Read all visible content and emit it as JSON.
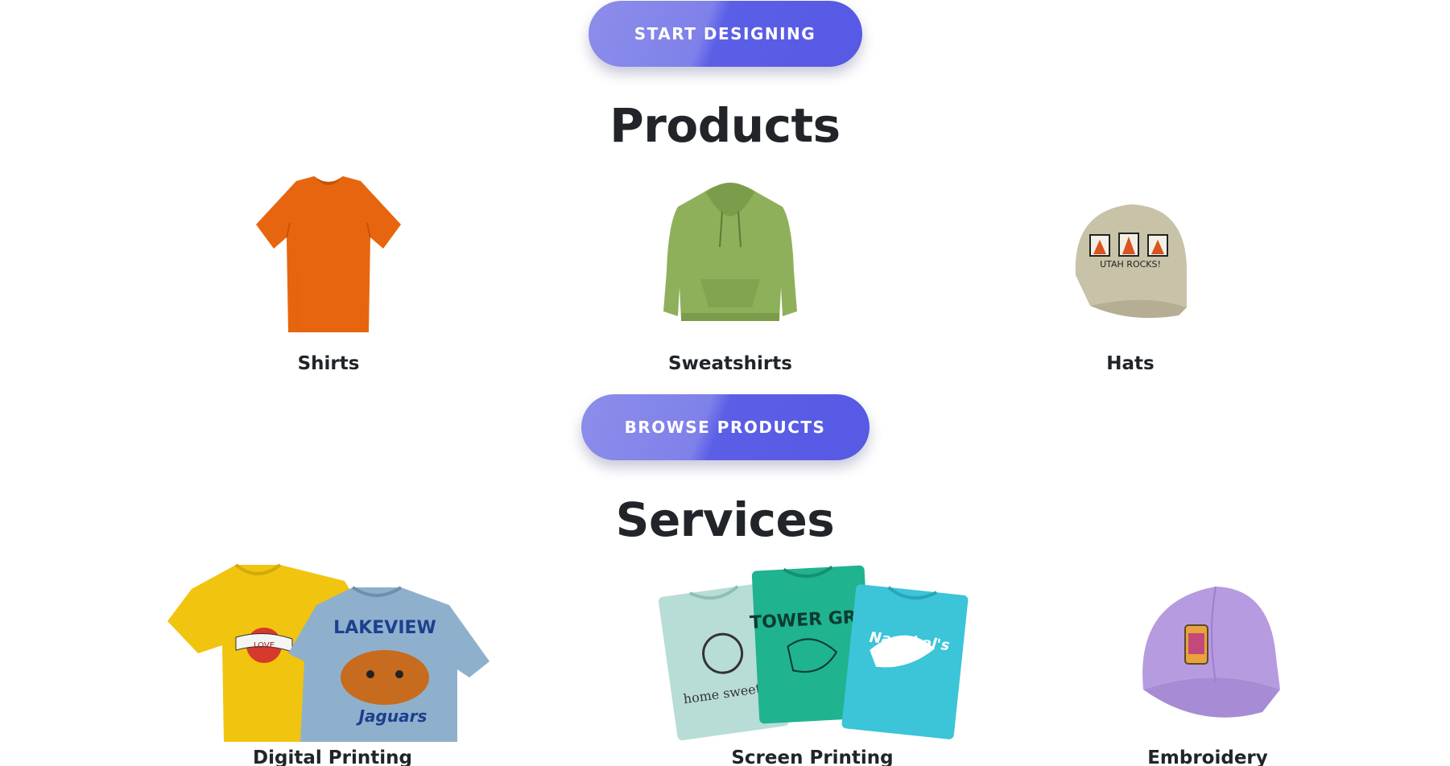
{
  "hero": {
    "start_button": "START DESIGNING"
  },
  "products": {
    "title": "Products",
    "items": [
      {
        "label": "Shirts",
        "icon": "orange-tshirt-image",
        "color": "#e8650f"
      },
      {
        "label": "Sweatshirts",
        "icon": "green-hoodie-image",
        "color": "#8fb05a"
      },
      {
        "label": "Hats",
        "icon": "khaki-cap-image",
        "color": "#c8c2a8",
        "print_text": "UTAH ROCKS!"
      }
    ],
    "browse_button": "BROWSE PRODUCTS"
  },
  "services": {
    "title": "Services",
    "items": [
      {
        "label": "Digital Printing",
        "icon": "printed-tshirts-image",
        "colors": [
          "#f1c40f",
          "#8fb0cc"
        ],
        "print_text": [
          "LOVE",
          "LAKEVIEW",
          "Jaguars"
        ]
      },
      {
        "label": "Screen Printing",
        "icon": "folded-tshirts-image",
        "colors": [
          "#b8ddd6",
          "#1fb390",
          "#3cc4d8"
        ],
        "print_text": [
          "home sweet h",
          "TOWER GRO",
          "Narwhal's"
        ]
      },
      {
        "label": "Embroidery",
        "icon": "lavender-cap-image",
        "color": "#b79be0"
      }
    ]
  }
}
